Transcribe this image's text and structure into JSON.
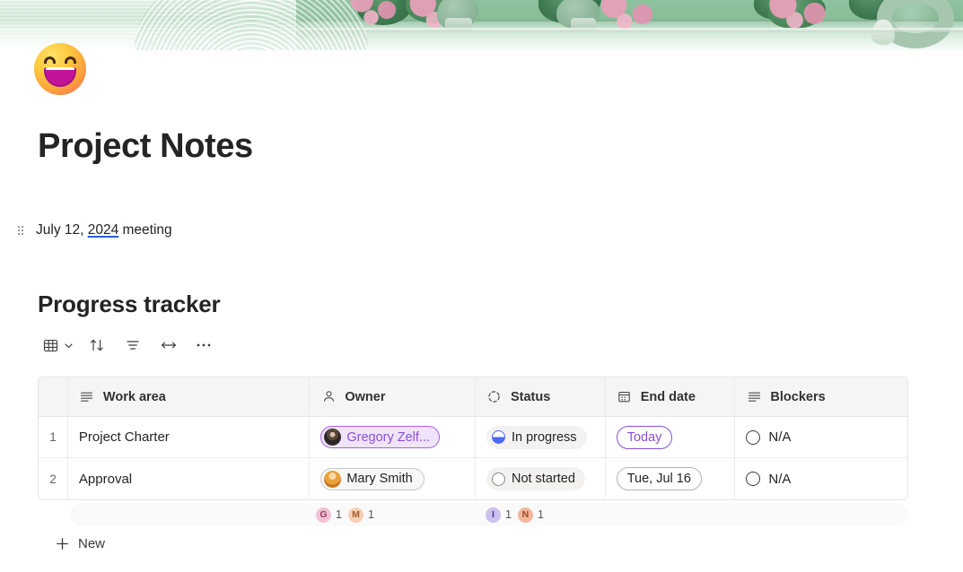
{
  "banner": {
    "alt": "green foliage wall banner"
  },
  "page": {
    "emoji_icon": "grinning-face-emoji",
    "title": "Project Notes",
    "paragraph": {
      "prefix": "July 12, ",
      "spellcheck_word": "2024",
      "suffix": " meeting"
    }
  },
  "section": {
    "heading": "Progress tracker",
    "toolbar": [
      {
        "name": "table-view-icon",
        "glyph": "grid"
      },
      {
        "name": "chevron-down-icon",
        "glyph": "chevron"
      },
      {
        "name": "sort-icon",
        "glyph": "sort"
      },
      {
        "name": "filter-icon",
        "glyph": "filter"
      },
      {
        "name": "fit-width-icon",
        "glyph": "resize"
      },
      {
        "name": "more-options-icon",
        "glyph": "ellipsis"
      }
    ]
  },
  "table": {
    "columns": [
      {
        "label": "Work area",
        "icon": "text-lines-icon"
      },
      {
        "label": "Owner",
        "icon": "person-icon"
      },
      {
        "label": "Status",
        "icon": "dashed-circle-icon"
      },
      {
        "label": "End date",
        "icon": "calendar-icon"
      },
      {
        "label": "Blockers",
        "icon": "text-lines-icon"
      }
    ],
    "rows": [
      {
        "num": "1",
        "work_area": "Project Charter",
        "owner": {
          "name": "Gregory Zelf...",
          "avatar": "photo-avatar",
          "style": "purple"
        },
        "status": {
          "label": "In progress",
          "indicator": "half-filled-circle"
        },
        "end_date": {
          "label": "Today",
          "style": "today"
        },
        "blockers": "N/A"
      },
      {
        "num": "2",
        "work_area": "Approval",
        "owner": {
          "name": "Mary Smith",
          "avatar": "mary-avatar",
          "style": "gray"
        },
        "status": {
          "label": "Not started",
          "indicator": "empty-circle"
        },
        "end_date": {
          "label": "Tue, Jul 16",
          "style": "plain"
        },
        "blockers": "N/A"
      }
    ],
    "summary": {
      "owner": [
        {
          "initial": "G",
          "count": "1",
          "color": "#f0c3d4"
        },
        {
          "initial": "M",
          "count": "1",
          "color": "#f7d0b4"
        }
      ],
      "status": [
        {
          "initial": "I",
          "count": "1",
          "color": "#ccc0ec"
        },
        {
          "initial": "N",
          "count": "1",
          "color": "#f2b79b"
        }
      ]
    },
    "new_row_label": "New"
  }
}
